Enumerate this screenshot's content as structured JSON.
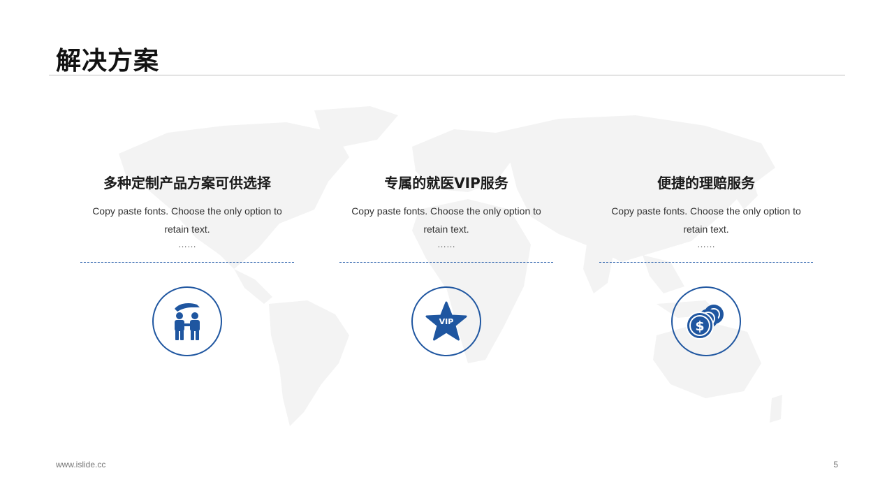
{
  "header": {
    "title": "解决方案"
  },
  "columns": [
    {
      "heading": "多种定制产品方案可供选择",
      "description": "Copy paste fonts. Choose the only option to retain text.",
      "ellipsis": "……",
      "icon": "people-protection-icon"
    },
    {
      "heading": "专属的就医VIP服务",
      "description": "Copy paste fonts. Choose the only option to retain text.",
      "ellipsis": "……",
      "icon": "vip-star-icon",
      "icon_text": "VIP"
    },
    {
      "heading": "便捷的理赔服务",
      "description": "Copy paste fonts. Choose the only option to retain text.",
      "ellipsis": "……",
      "icon": "coins-icon",
      "icon_text": "$"
    }
  ],
  "footer": {
    "url": "www.islide.cc",
    "page_number": "5"
  },
  "colors": {
    "accent": "#1f56a0",
    "background_map": "#f3f3f3"
  }
}
